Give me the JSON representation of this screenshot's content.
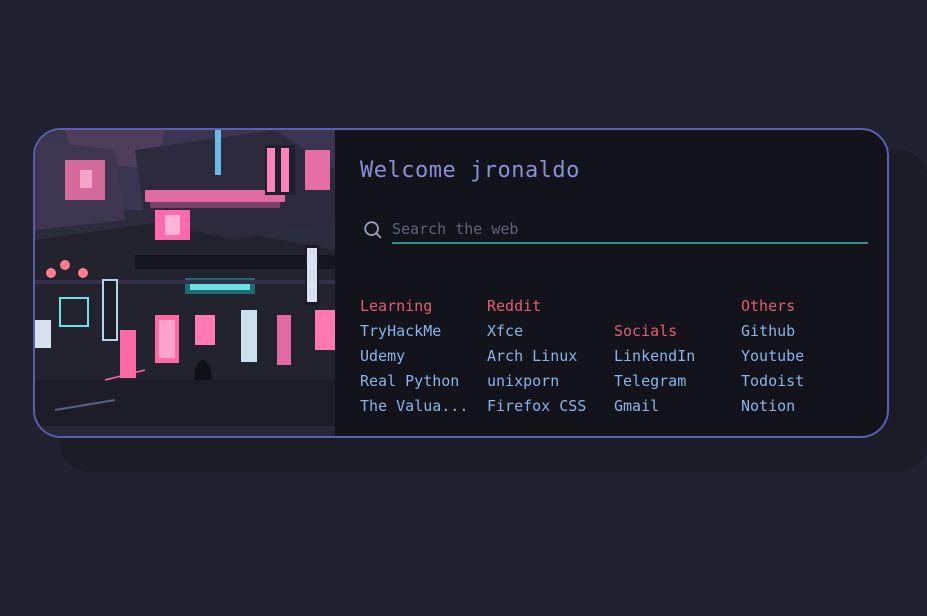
{
  "welcome": "Welcome jronaldo",
  "search": {
    "placeholder": "Search the web"
  },
  "columns": [
    {
      "title": "Learning",
      "links": [
        "TryHackMe",
        "Udemy",
        "Real Python",
        "The Valua..."
      ]
    },
    {
      "title": "Reddit",
      "links": [
        "Xfce",
        "Arch Linux",
        "unixporn",
        "Firefox CSS"
      ]
    },
    {
      "title": "Socials",
      "links": [
        "LinkendIn",
        "Telegram",
        "Gmail"
      ]
    },
    {
      "title": "Others",
      "links": [
        "Github",
        "Youtube",
        "Todoist",
        "Notion"
      ]
    }
  ],
  "colors": {
    "background": "#202231",
    "card": "#12131b",
    "border": "#5a5fb0",
    "heading": "#e45d71",
    "link": "#8ab4e6",
    "welcome": "#8b8fd6",
    "search_line": "#2f8f94"
  },
  "icons": {
    "search": "search-icon"
  }
}
